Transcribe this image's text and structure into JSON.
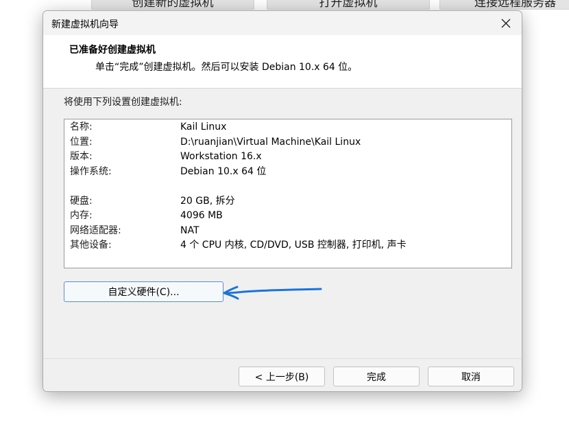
{
  "background_tabs": [
    "创建新的虚拟机",
    "打开虚拟机",
    "连接远程服务器"
  ],
  "dialog": {
    "title": "新建虚拟机向导",
    "close_icon": "close-icon",
    "header_title": "已准备好创建虚拟机",
    "header_subtitle": "单击“完成”创建虚拟机。然后可以安装 Debian 10.x 64 位。"
  },
  "intro_text": "将使用下列设置创建虚拟机:",
  "summary": [
    {
      "key": "名称:",
      "value": "Kail Linux"
    },
    {
      "key": "位置:",
      "value": "D:\\ruanjian\\Virtual Machine\\Kail Linux"
    },
    {
      "key": "版本:",
      "value": "Workstation 16.x"
    },
    {
      "key": "操作系统:",
      "value": "Debian 10.x 64 位"
    },
    {
      "key": "硬盘:",
      "value": "20 GB, 拆分"
    },
    {
      "key": "内存:",
      "value": "4096 MB"
    },
    {
      "key": "网络适配器:",
      "value": "NAT"
    },
    {
      "key": "其他设备:",
      "value": "4 个 CPU 内核, CD/DVD, USB 控制器, 打印机, 声卡"
    }
  ],
  "customize_button": "自定义硬件(C)...",
  "footer": {
    "back": "< 上一步(B)",
    "finish": "完成",
    "cancel": "取消"
  },
  "colors": {
    "annotation_arrow": "#1a73d9",
    "button_focus_border": "#5a8fc8"
  }
}
